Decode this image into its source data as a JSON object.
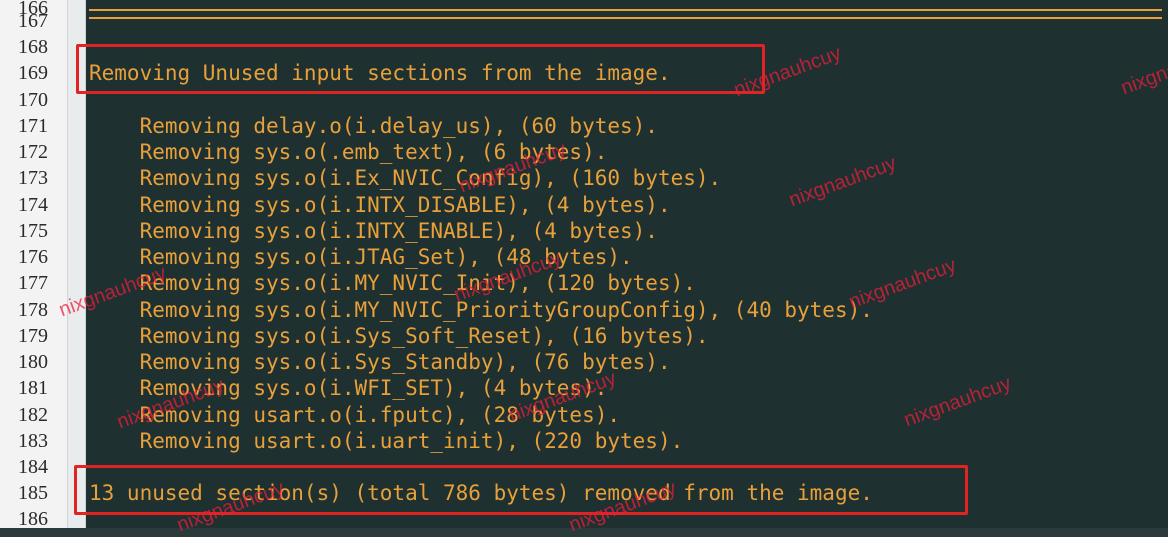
{
  "line_numbers": [
    "166",
    "167",
    "168",
    "169",
    "170",
    "171",
    "172",
    "173",
    "174",
    "175",
    "176",
    "177",
    "178",
    "179",
    "180",
    "181",
    "182",
    "183",
    "184",
    "185",
    "186"
  ],
  "lines": {
    "removing_header": "Removing Unused input sections from the image.",
    "removals": [
      "    Removing delay.o(i.delay_us), (60 bytes).",
      "    Removing sys.o(.emb_text), (6 bytes).",
      "    Removing sys.o(i.Ex_NVIC_Config), (160 bytes).",
      "    Removing sys.o(i.INTX_DISABLE), (4 bytes).",
      "    Removing sys.o(i.INTX_ENABLE), (4 bytes).",
      "    Removing sys.o(i.JTAG_Set), (48 bytes).",
      "    Removing sys.o(i.MY_NVIC_Init), (120 bytes).",
      "    Removing sys.o(i.MY_NVIC_PriorityGroupConfig), (40 bytes).",
      "    Removing sys.o(i.Sys_Soft_Reset), (16 bytes).",
      "    Removing sys.o(i.Sys_Standby), (76 bytes).",
      "    Removing sys.o(i.WFI_SET), (4 bytes).",
      "    Removing usart.o(i.fputc), (28 bytes).",
      "    Removing usart.o(i.uart_init), (220 bytes)."
    ],
    "summary": "13 unused section(s) (total 786 bytes) removed from the image."
  },
  "watermark": "nixgnauhcuy",
  "colors": {
    "text": "#e8a03a",
    "background": "#1f3030",
    "highlight": "#e02424"
  }
}
